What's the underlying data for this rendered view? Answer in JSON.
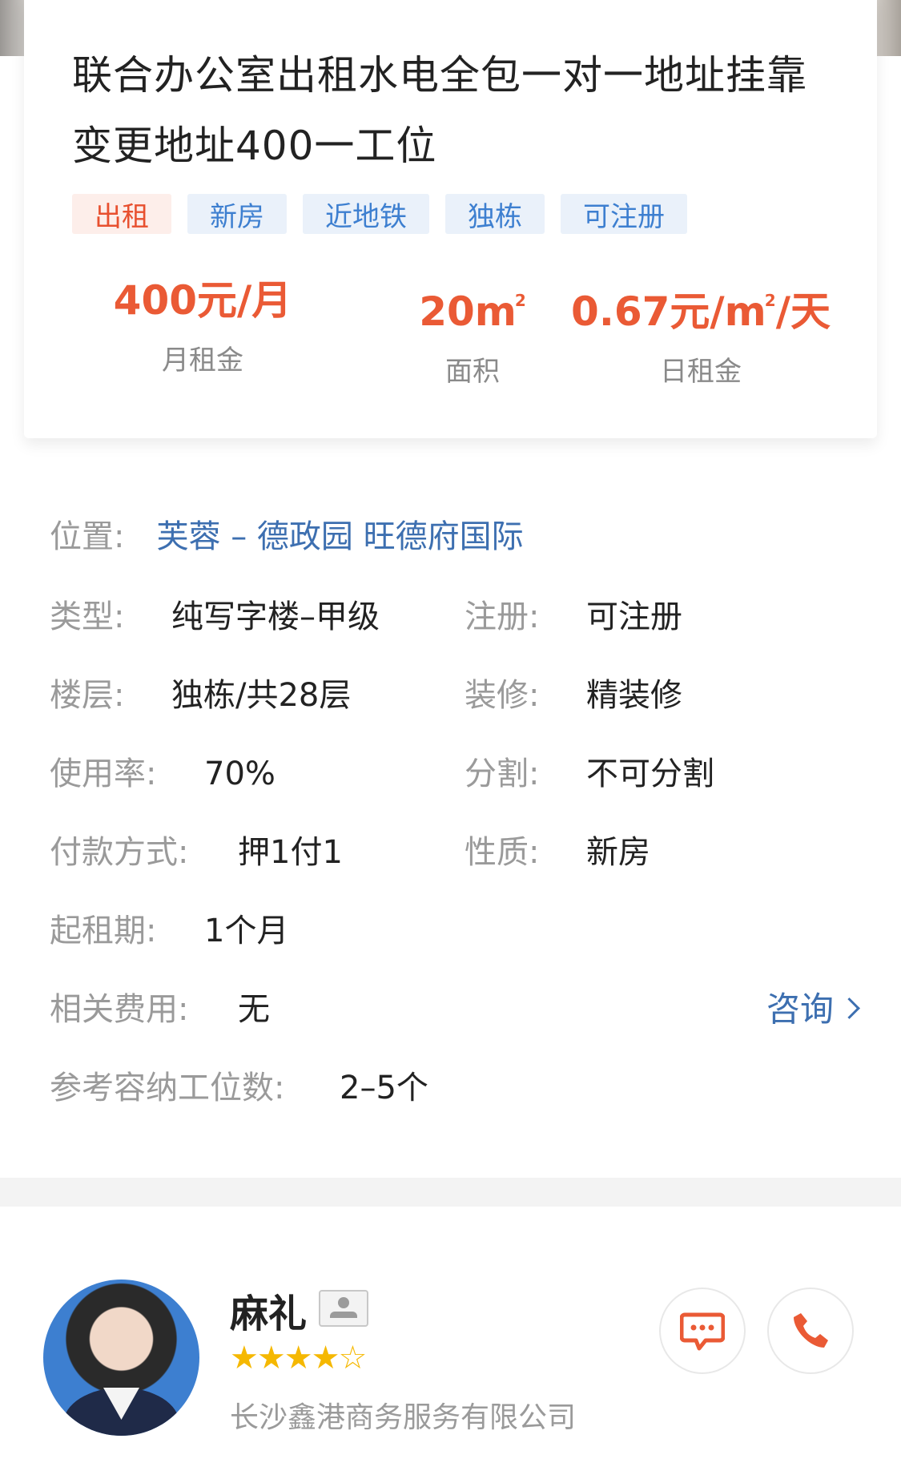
{
  "listing": {
    "title": "联合办公室出租水电全包一对一地址挂靠变更地址400一工位",
    "tags": [
      {
        "label": "出租",
        "style": "red"
      },
      {
        "label": "新房",
        "style": "blue"
      },
      {
        "label": "近地铁",
        "style": "blue"
      },
      {
        "label": "独栋",
        "style": "blue"
      },
      {
        "label": "可注册",
        "style": "blue"
      }
    ],
    "stats": {
      "monthly_rent": {
        "value": "400元/月",
        "label": "月租金"
      },
      "area": {
        "value": "20m",
        "label": "面积",
        "sup": "2"
      },
      "daily_rent": {
        "value_prefix": "0.67元/m",
        "sup": "2",
        "value_suffix": "/天",
        "label": "日租金"
      }
    }
  },
  "details": {
    "location": {
      "key": "位置:",
      "value": "芙蓉 – 德政园 旺德府国际"
    },
    "type": {
      "key": "类型:",
      "value": "纯写字楼–甲级"
    },
    "register": {
      "key": "注册:",
      "value": "可注册"
    },
    "floor": {
      "key": "楼层:",
      "value": "独栋/共28层"
    },
    "decoration": {
      "key": "装修:",
      "value": "精装修"
    },
    "usage_rate": {
      "key": "使用率:",
      "value": "70%"
    },
    "split": {
      "key": "分割:",
      "value": "不可分割"
    },
    "payment": {
      "key": "付款方式:",
      "value": "押1付1"
    },
    "nature": {
      "key": "性质:",
      "value": "新房"
    },
    "min_lease": {
      "key": "起租期:",
      "value": "1个月"
    },
    "fees": {
      "key": "相关费用:",
      "value": "无",
      "consult": "咨询"
    },
    "capacity": {
      "key": "参考容纳工位数:",
      "value": "2–5个"
    }
  },
  "agent": {
    "name": "麻礼",
    "rating": 4,
    "rating_max": 5,
    "company": "长沙鑫港商务服务有限公司"
  },
  "colors": {
    "accent_orange": "#ea5a35",
    "link_blue": "#3d6fb0",
    "star": "#f5b800"
  },
  "icons": [
    "id-card-icon",
    "chat-icon",
    "phone-icon",
    "chevron-right-icon",
    "star-icon"
  ]
}
